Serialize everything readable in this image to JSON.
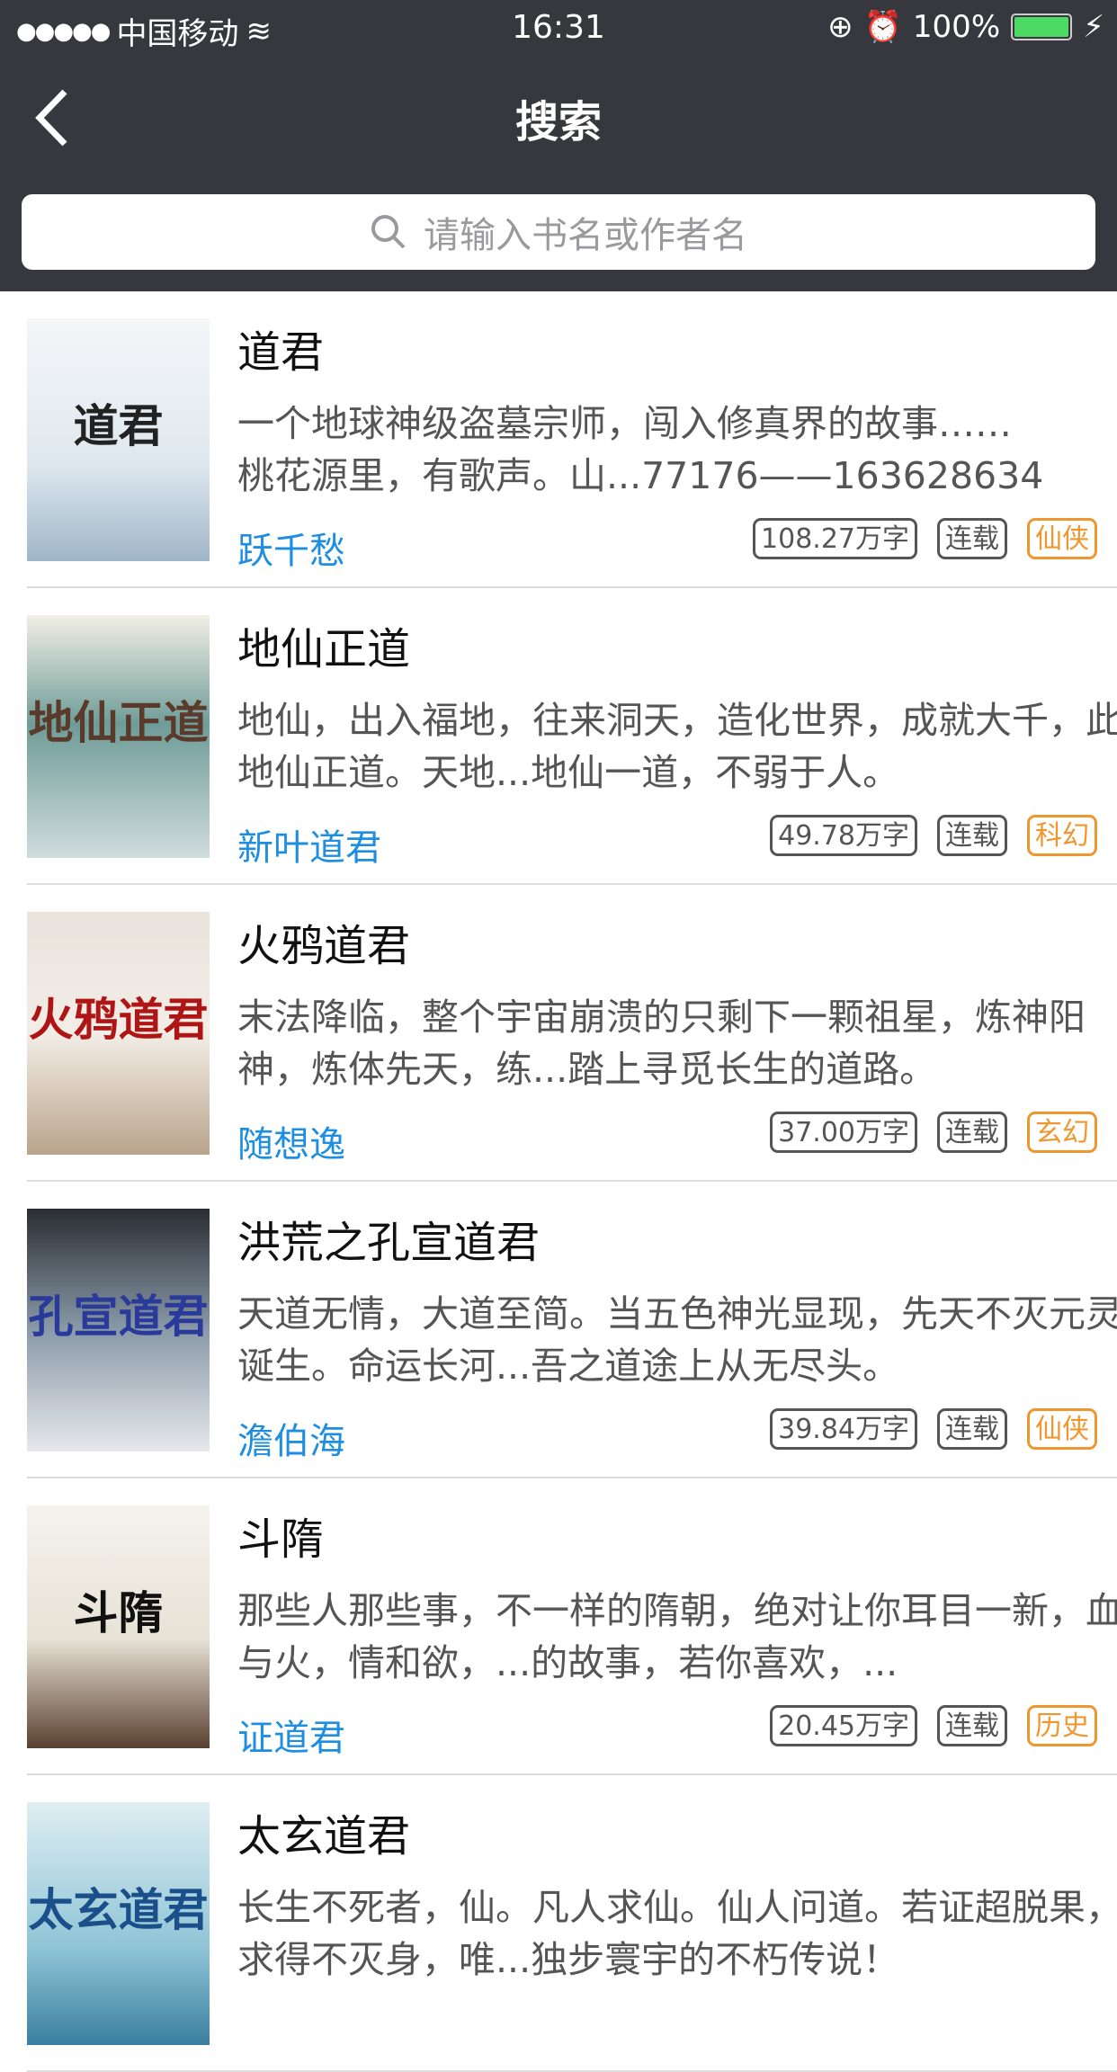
{
  "status": {
    "carrier": "中国移动",
    "time": "16:31",
    "battery": "100%"
  },
  "nav": {
    "title": "搜索"
  },
  "search": {
    "placeholder": "请输入书名或作者名"
  },
  "books": [
    {
      "title": "道君",
      "desc": "一个地球神级盗墓宗师，闯入修真界的故事……\n桃花源里，有歌声。山...77176——163628634",
      "author": "跃千愁",
      "words": "108.27万字",
      "status": "连载",
      "category": "仙侠",
      "cover_text": "道君",
      "cover_bg": "linear-gradient(#f4f6f8,#dfe8ef 60%,#9fb6c8)",
      "cover_fg": "#222"
    },
    {
      "title": "地仙正道",
      "desc": "地仙，出入福地，往来洞天，造化世界，成就大千，此地仙正道。天地...地仙一道，不弱于人。",
      "author": "新叶道君",
      "words": "49.78万字",
      "status": "连载",
      "category": "科幻",
      "cover_text": "地仙正道",
      "cover_bg": "linear-gradient(#f2efe6,#6f9c98 45%,#cfdcdc)",
      "cover_fg": "#5a3a2a"
    },
    {
      "title": "火鸦道君",
      "desc": "末法降临，整个宇宙崩溃的只剩下一颗祖星，炼神阳神，炼体先天，练...踏上寻觅长生的道路。",
      "author": "随想逸",
      "words": "37.00万字",
      "status": "连载",
      "category": "玄幻",
      "cover_text": "火鸦道君",
      "cover_bg": "linear-gradient(#e9e3dc,#f2ede6 50%,#b9a48c)",
      "cover_fg": "#b01515"
    },
    {
      "title": "洪荒之孔宣道君",
      "desc": "天道无情，大道至简。当五色神光显现，先天不灭元灵诞生。命运长河...吾之道途上从无尽头。",
      "author": "澹伯海",
      "words": "39.84万字",
      "status": "连载",
      "category": "仙侠",
      "cover_text": "孔宣道君",
      "cover_bg": "linear-gradient(#2a2d33,#8a9aa8 50%,#e6e8ec)",
      "cover_fg": "#2a3a9a"
    },
    {
      "title": "斗隋",
      "desc": "那些人那些事，不一样的隋朝，绝对让你耳目一新，血与火，情和欲，...的故事，若你喜欢，...",
      "author": "证道君",
      "words": "20.45万字",
      "status": "连载",
      "category": "历史",
      "cover_text": "斗隋",
      "cover_bg": "linear-gradient(#f5f3ee,#e8e2d6 55%,#5a4030)",
      "cover_fg": "#111"
    },
    {
      "title": "太玄道君",
      "desc": "长生不死者，仙。凡人求仙。仙人问道。若证超脱果，求得不灭身，唯...独步寰宇的不朽传说！",
      "author": "",
      "words": "",
      "status": "",
      "category": "",
      "cover_text": "太玄道君",
      "cover_bg": "linear-gradient(#dfeef2,#8fc4d6 60%,#3a7fa0)",
      "cover_fg": "#1a4f8a"
    }
  ]
}
